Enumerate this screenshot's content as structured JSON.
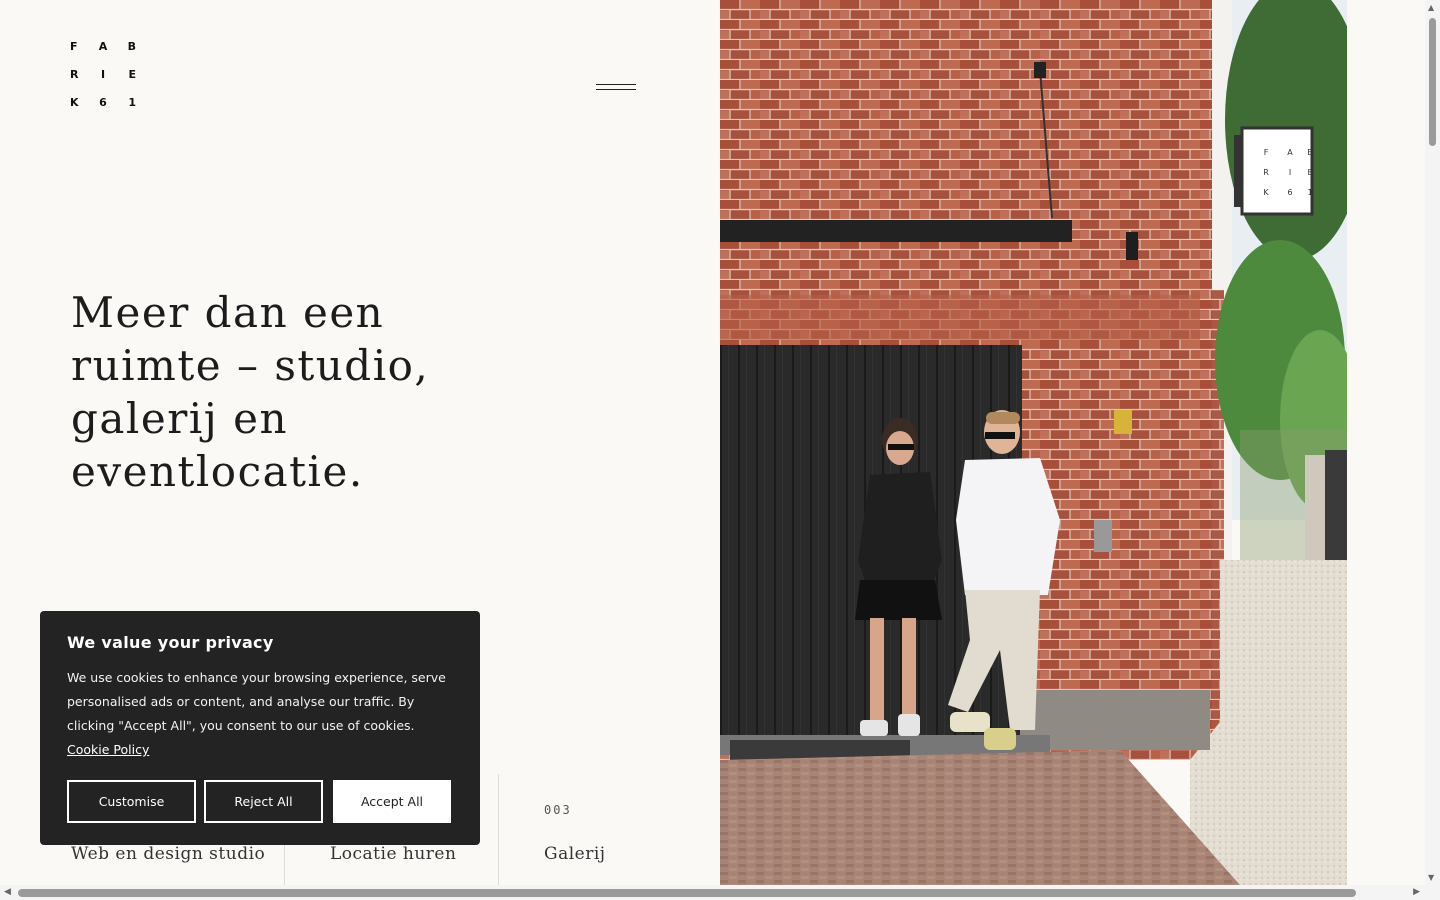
{
  "logo": {
    "letters": [
      "F",
      "A",
      "B",
      "R",
      "I",
      "E",
      "K",
      "6",
      "1"
    ]
  },
  "menu": {
    "icon": "hamburger-icon"
  },
  "hero": {
    "title": "Meer dan een ruimte – studio, galerij en eventlocatie."
  },
  "services": [
    {
      "num": "",
      "name": "Web en design studio"
    },
    {
      "num": "",
      "name": "Locatie huren"
    },
    {
      "num": "003",
      "name": "Galerij"
    }
  ],
  "photo": {
    "sign_letters": [
      "F",
      "A",
      "B",
      "R",
      "I",
      "E",
      "K",
      "6",
      "1"
    ]
  },
  "cookie": {
    "title": "We value your privacy",
    "text": "We use cookies to enhance your browsing experience, serve personalised ads or content, and analyse our traffic. By clicking \"Accept All\", you consent to our use of cookies.",
    "link": "Cookie Policy",
    "customise": "Customise",
    "reject": "Reject All",
    "accept": "Accept All"
  }
}
